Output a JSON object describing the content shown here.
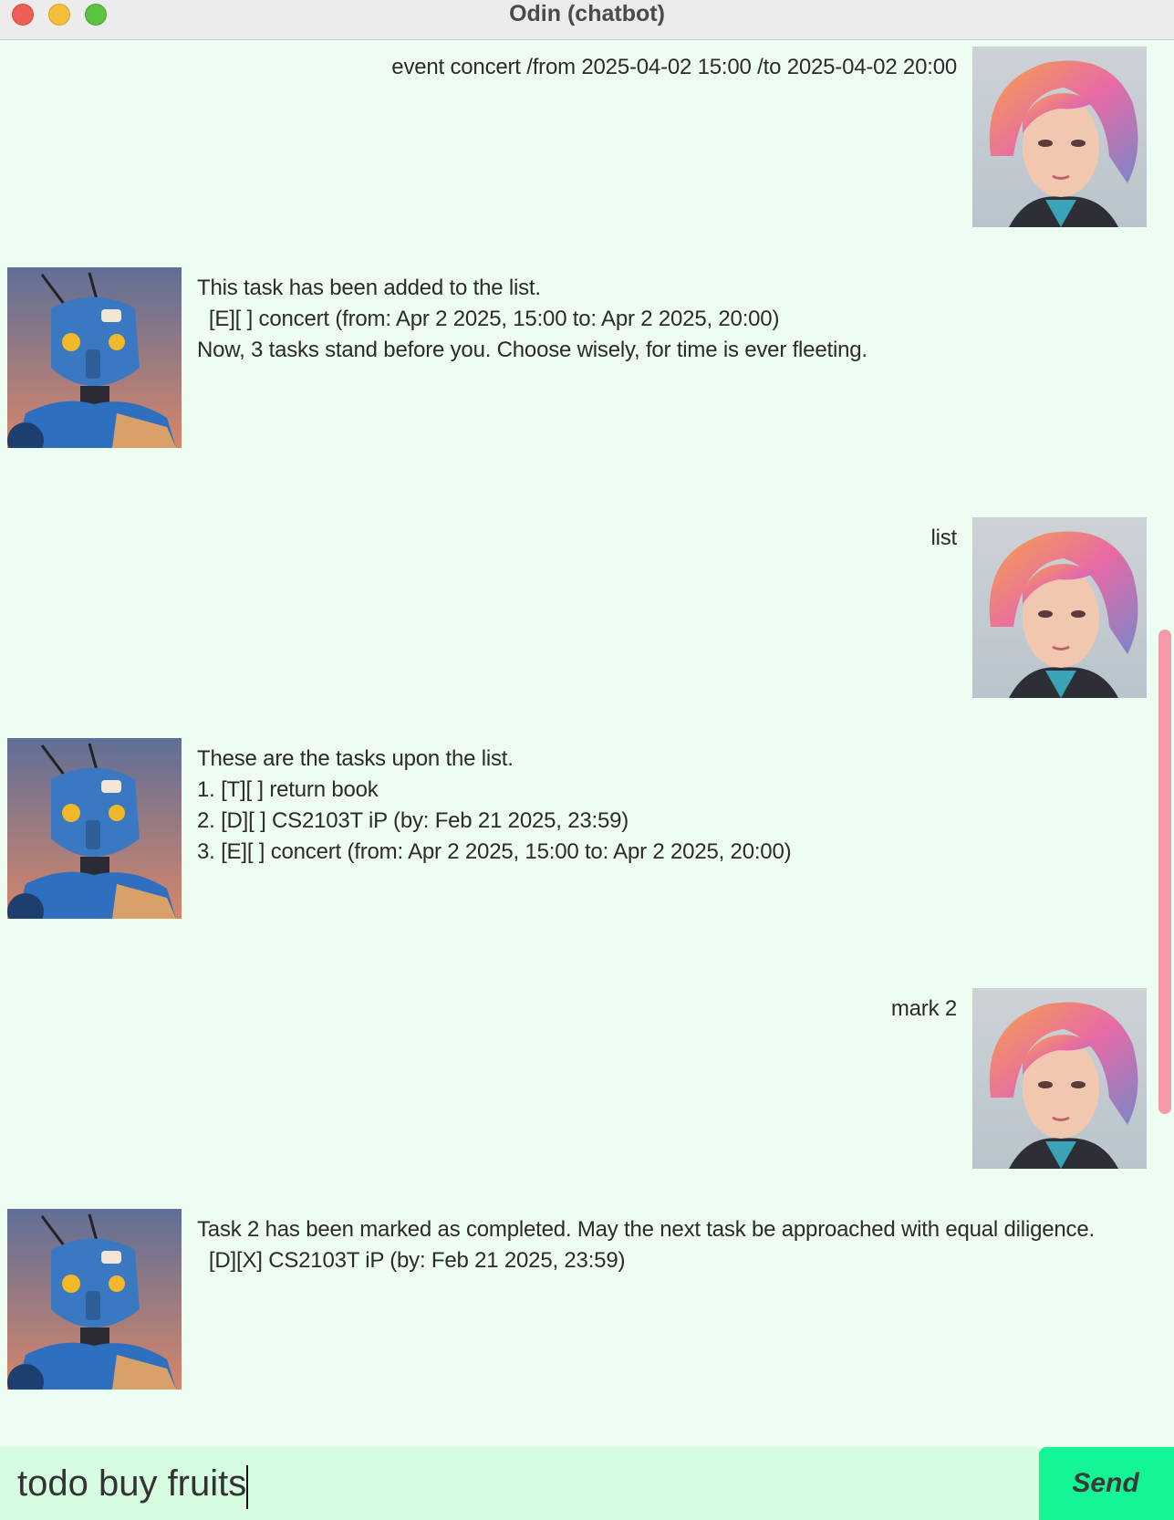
{
  "window": {
    "title": "Odin (chatbot)"
  },
  "messages": [
    {
      "role": "user",
      "text": "event concert /from 2025-04-02 15:00 /to 2025-04-02 20:00"
    },
    {
      "role": "bot",
      "text": "This task has been added to the list.\n  [E][ ] concert (from: Apr 2 2025, 15:00 to: Apr 2 2025, 20:00)\nNow, 3 tasks stand before you. Choose wisely, for time is ever fleeting."
    },
    {
      "role": "user",
      "text": "list"
    },
    {
      "role": "bot",
      "text": "These are the tasks upon the list.\n1. [T][ ] return book\n2. [D][ ] CS2103T iP (by: Feb 21 2025, 23:59)\n3. [E][ ] concert (from: Apr 2 2025, 15:00 to: Apr 2 2025, 20:00)"
    },
    {
      "role": "user",
      "text": "mark 2"
    },
    {
      "role": "bot",
      "text": "Task 2 has been marked as completed. May the next task be approached with equal diligence.\n  [D][X] CS2103T iP (by: Feb 21 2025, 23:59)"
    }
  ],
  "avatars": {
    "user": "user-portrait-avatar",
    "bot": "robot-portrait-avatar"
  },
  "input": {
    "value": "todo buy fruits",
    "placeholder": ""
  },
  "send_button": {
    "label": "Send"
  },
  "colors": {
    "background": "#eefdf1",
    "input_background": "#d6fde0",
    "send_button": "#14f596",
    "scrollbar": "#f49aa9"
  }
}
